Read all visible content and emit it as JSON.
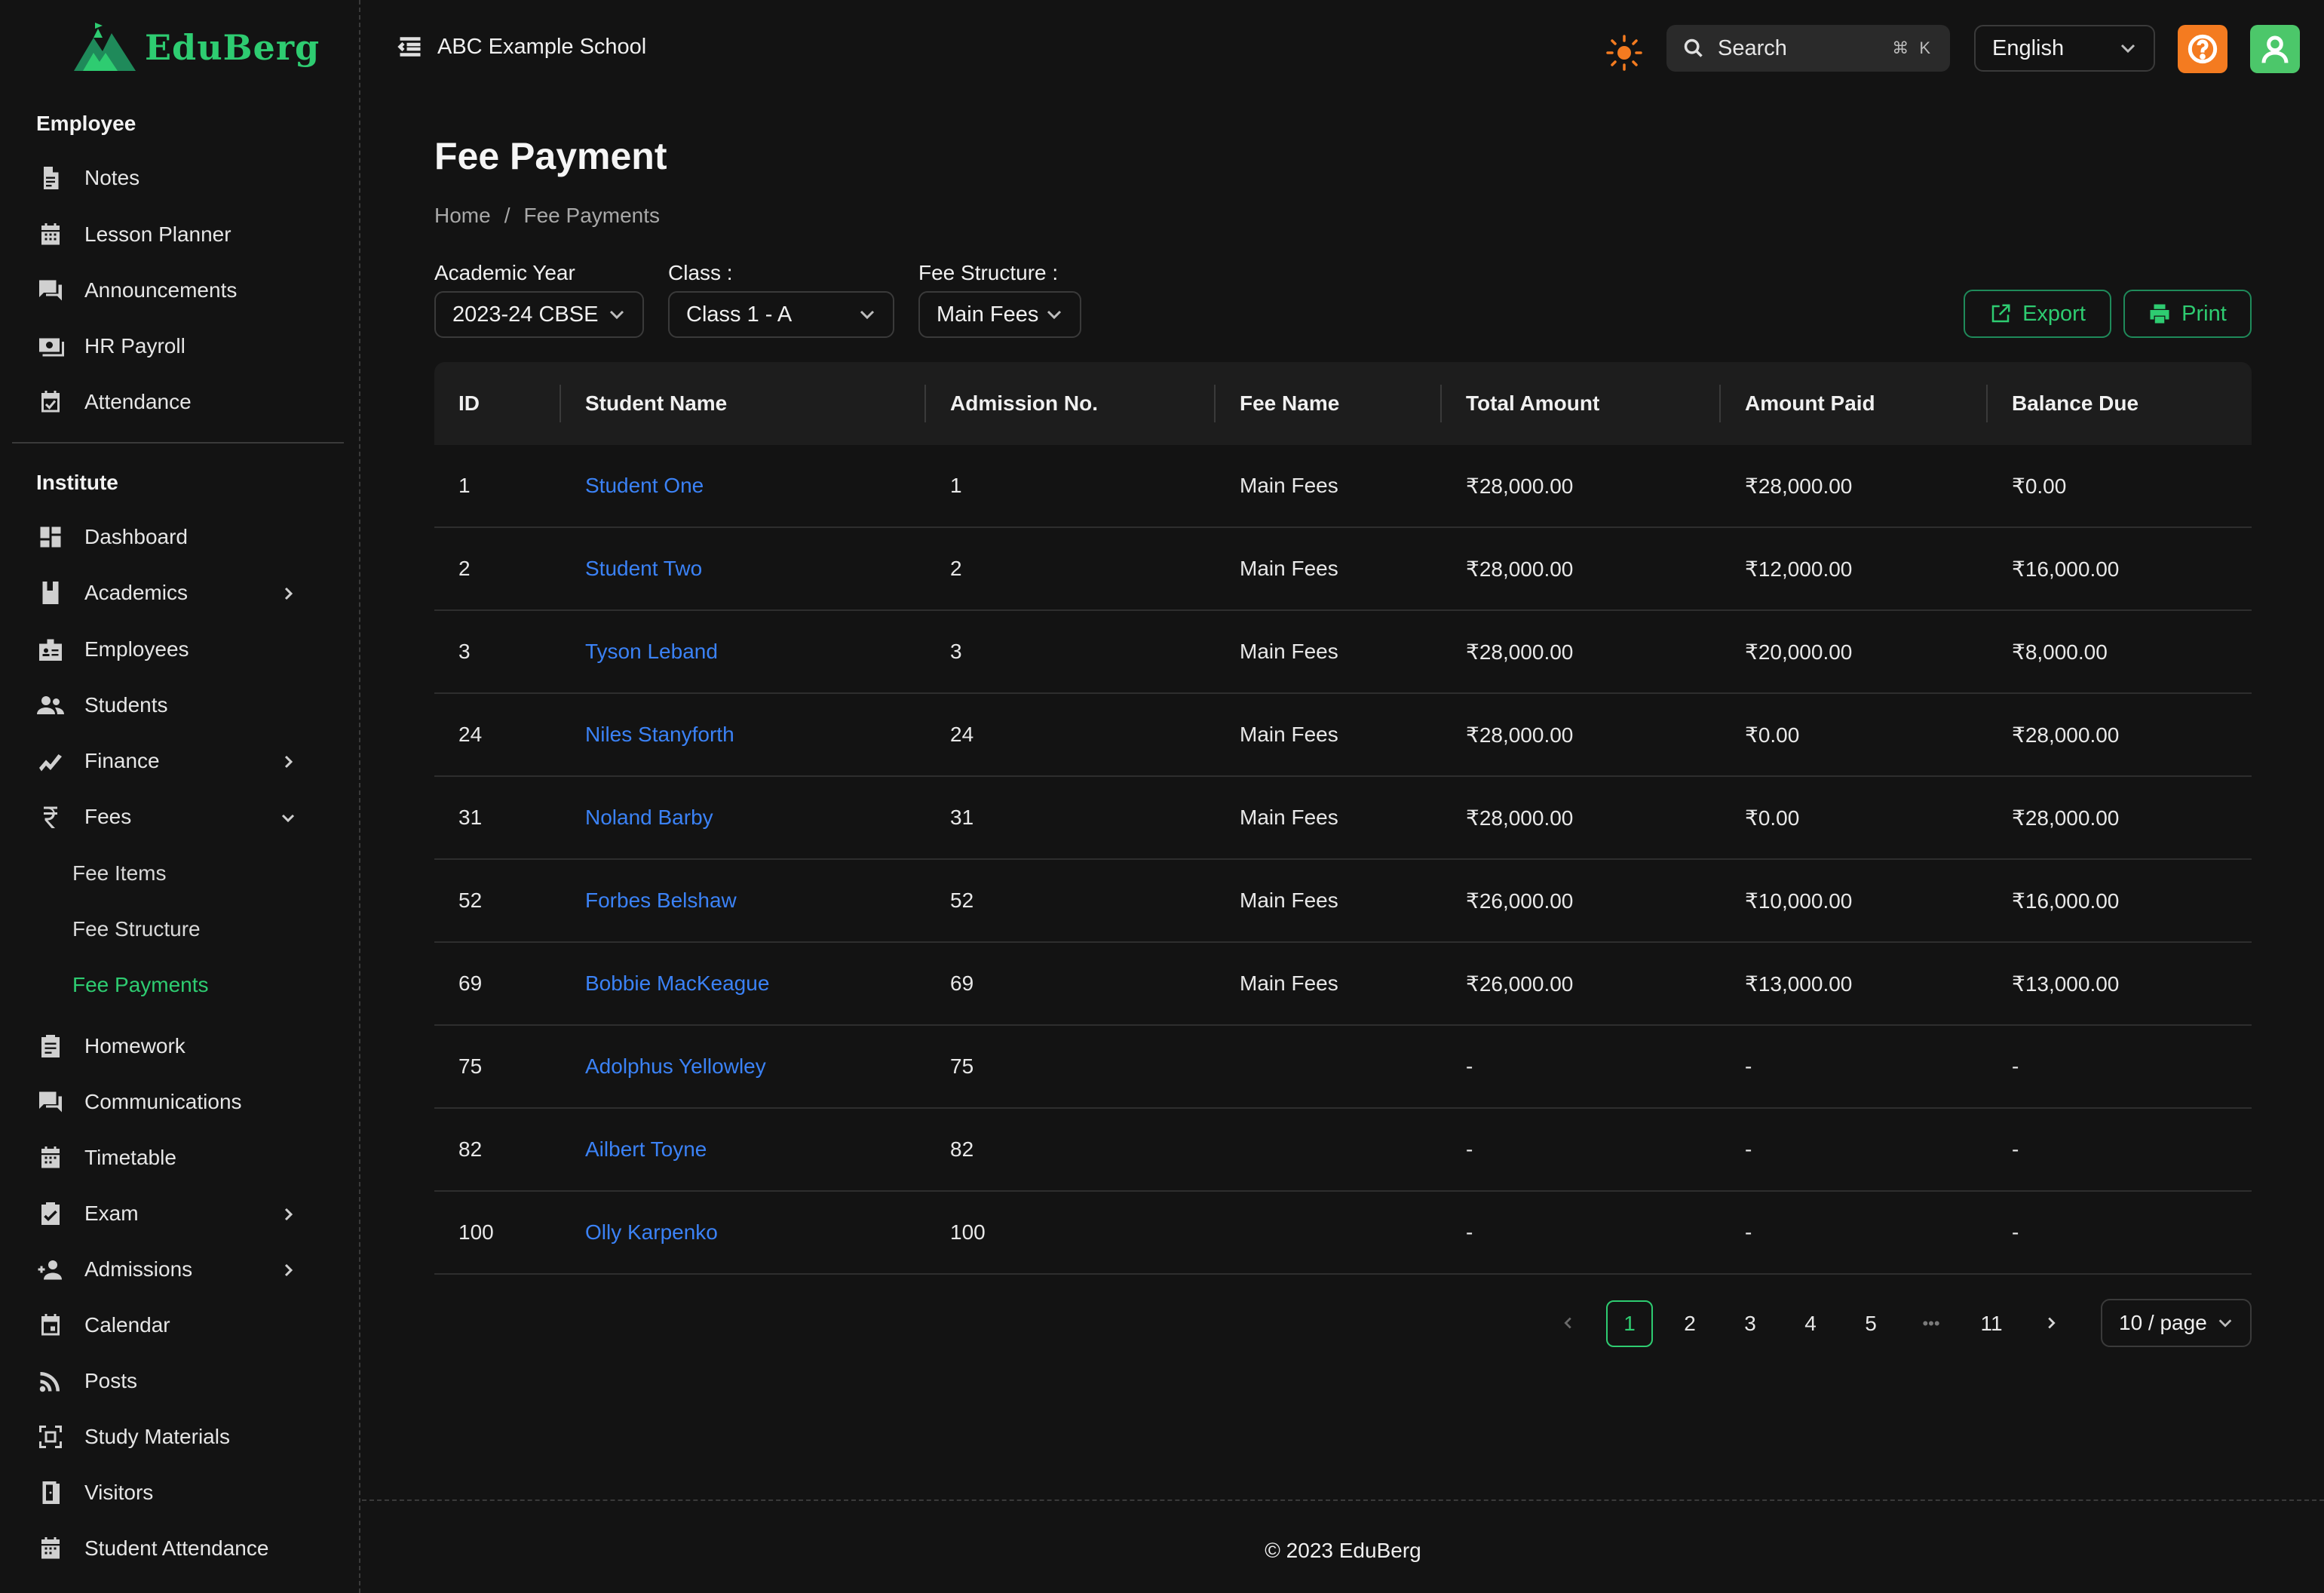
{
  "brand": {
    "name": "EduBerg",
    "accent": "#2ecc71"
  },
  "header": {
    "school_name": "ABC Example School",
    "search_placeholder": "Search",
    "search_shortcut": "⌘ K",
    "language": "English"
  },
  "sidebar": {
    "employee_title": "Employee",
    "employee_items": [
      {
        "label": "Notes",
        "icon": "document-icon"
      },
      {
        "label": "Lesson Planner",
        "icon": "calendar-icon"
      },
      {
        "label": "Announcements",
        "icon": "chat-icon"
      },
      {
        "label": "HR Payroll",
        "icon": "payroll-icon"
      },
      {
        "label": "Attendance",
        "icon": "calendar-check-icon"
      }
    ],
    "institute_title": "Institute",
    "institute_items": [
      {
        "label": "Dashboard",
        "icon": "dashboard-icon"
      },
      {
        "label": "Academics",
        "icon": "book-icon"
      },
      {
        "label": "Employees",
        "icon": "badge-icon"
      },
      {
        "label": "Students",
        "icon": "people-icon"
      },
      {
        "label": "Finance",
        "icon": "chart-line-icon"
      },
      {
        "label": "Fees",
        "icon": "rupee-icon"
      }
    ],
    "fees_sub_items": [
      {
        "label": "Fee Items"
      },
      {
        "label": "Fee Structure"
      },
      {
        "label": "Fee Payments"
      }
    ],
    "more_items": [
      {
        "label": "Homework",
        "icon": "clipboard-icon"
      },
      {
        "label": "Communications",
        "icon": "chat-icon"
      },
      {
        "label": "Timetable",
        "icon": "calendar-icon"
      },
      {
        "label": "Exam",
        "icon": "clipboard-check-icon"
      },
      {
        "label": "Admissions",
        "icon": "person-add-icon"
      },
      {
        "label": "Calendar",
        "icon": "calendar-day-icon"
      },
      {
        "label": "Posts",
        "icon": "rss-icon"
      },
      {
        "label": "Study Materials",
        "icon": "scan-icon"
      },
      {
        "label": "Visitors",
        "icon": "door-icon"
      },
      {
        "label": "Student Attendance",
        "icon": "calendar-icon"
      }
    ]
  },
  "page": {
    "title": "Fee Payment",
    "breadcrumb": [
      "Home",
      "/",
      "Fee Payments"
    ]
  },
  "filters": {
    "academic_year_label": "Academic Year",
    "academic_year_value": "2023-24 CBSE",
    "class_label": "Class :",
    "class_value": "Class 1 - A",
    "fee_structure_label": "Fee Structure :",
    "fee_structure_value": "Main Fees"
  },
  "actions": {
    "export_label": "Export",
    "print_label": "Print"
  },
  "table": {
    "columns": [
      "ID",
      "Student Name",
      "Admission No.",
      "Fee Name",
      "Total Amount",
      "Amount Paid",
      "Balance Due"
    ],
    "rows": [
      [
        "1",
        "Student One",
        "1",
        "Main Fees",
        "₹28,000.00",
        "₹28,000.00",
        "₹0.00"
      ],
      [
        "2",
        "Student Two",
        "2",
        "Main Fees",
        "₹28,000.00",
        "₹12,000.00",
        "₹16,000.00"
      ],
      [
        "3",
        "Tyson Leband",
        "3",
        "Main Fees",
        "₹28,000.00",
        "₹20,000.00",
        "₹8,000.00"
      ],
      [
        "24",
        "Niles Stanyforth",
        "24",
        "Main Fees",
        "₹28,000.00",
        "₹0.00",
        "₹28,000.00"
      ],
      [
        "31",
        "Noland Barby",
        "31",
        "Main Fees",
        "₹28,000.00",
        "₹0.00",
        "₹28,000.00"
      ],
      [
        "52",
        "Forbes Belshaw",
        "52",
        "Main Fees",
        "₹26,000.00",
        "₹10,000.00",
        "₹16,000.00"
      ],
      [
        "69",
        "Bobbie MacKeague",
        "69",
        "Main Fees",
        "₹26,000.00",
        "₹13,000.00",
        "₹13,000.00"
      ],
      [
        "75",
        "Adolphus Yellowley",
        "75",
        "",
        "-",
        "-",
        "-"
      ],
      [
        "82",
        "Ailbert Toyne",
        "82",
        "",
        "-",
        "-",
        "-"
      ],
      [
        "100",
        "Olly Karpenko",
        "100",
        "",
        "-",
        "-",
        "-"
      ]
    ]
  },
  "pagination": {
    "pages": [
      "1",
      "2",
      "3",
      "4",
      "5"
    ],
    "ellipsis": "•••",
    "last_page": "11",
    "page_size": "10 / page"
  },
  "footer": {
    "copyright": "© 2023 EduBerg"
  }
}
